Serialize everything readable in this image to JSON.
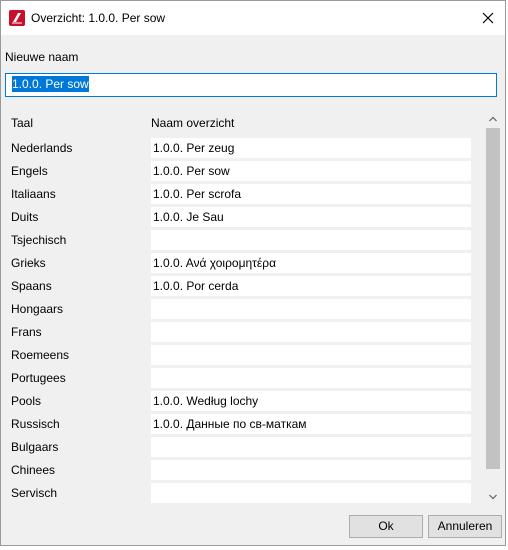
{
  "window": {
    "title": "Overzicht: 1.0.0. Per sow"
  },
  "form": {
    "name_label": "Nieuwe naam",
    "name_value": "1.0.0. Per sow"
  },
  "grid": {
    "header_language": "Taal",
    "header_name": "Naam overzicht",
    "rows": [
      {
        "language": "Nederlands",
        "name": "1.0.0. Per zeug"
      },
      {
        "language": "Engels",
        "name": "1.0.0. Per sow"
      },
      {
        "language": "Italiaans",
        "name": "1.0.0. Per scrofa"
      },
      {
        "language": "Duits",
        "name": "1.0.0. Je Sau"
      },
      {
        "language": "Tsjechisch",
        "name": ""
      },
      {
        "language": "Grieks",
        "name": "1.0.0. Ανά χοιρομητέρα"
      },
      {
        "language": "Spaans",
        "name": "1.0.0. Por cerda"
      },
      {
        "language": "Hongaars",
        "name": ""
      },
      {
        "language": "Frans",
        "name": ""
      },
      {
        "language": "Roemeens",
        "name": ""
      },
      {
        "language": "Portugees",
        "name": ""
      },
      {
        "language": "Pools",
        "name": "1.0.0. Według lochy"
      },
      {
        "language": "Russisch",
        "name": "1.0.0. Данные по св-маткам"
      },
      {
        "language": "Bulgaars",
        "name": ""
      },
      {
        "language": "Chinees",
        "name": ""
      },
      {
        "language": "Servisch",
        "name": ""
      }
    ]
  },
  "buttons": {
    "ok_label": "Ok",
    "cancel_label": "Annuleren"
  },
  "icons": {
    "app": "app-logo-icon",
    "close": "close-icon",
    "scroll_up": "chevron-up-icon",
    "scroll_down": "chevron-down-icon"
  },
  "colors": {
    "accent": "#0078d7",
    "app_icon": "#c8102e"
  }
}
